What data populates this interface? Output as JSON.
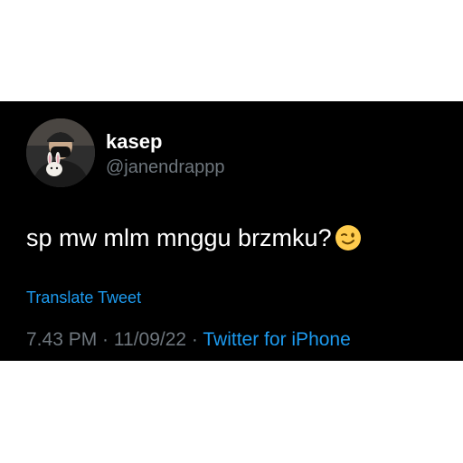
{
  "tweet": {
    "display_name": "kasep",
    "handle": "@janendrappp",
    "text": "sp mw mlm mnggu brzmku?",
    "emoji_icon": "winking-face-icon",
    "translate_label": "Translate Tweet",
    "time": "7.43 PM",
    "separator": " · ",
    "date": "11/09/22",
    "source": "Twitter for iPhone"
  },
  "colors": {
    "background": "#000000",
    "link": "#1d9bf0",
    "muted": "#6e767d",
    "text": "#ffffff"
  }
}
